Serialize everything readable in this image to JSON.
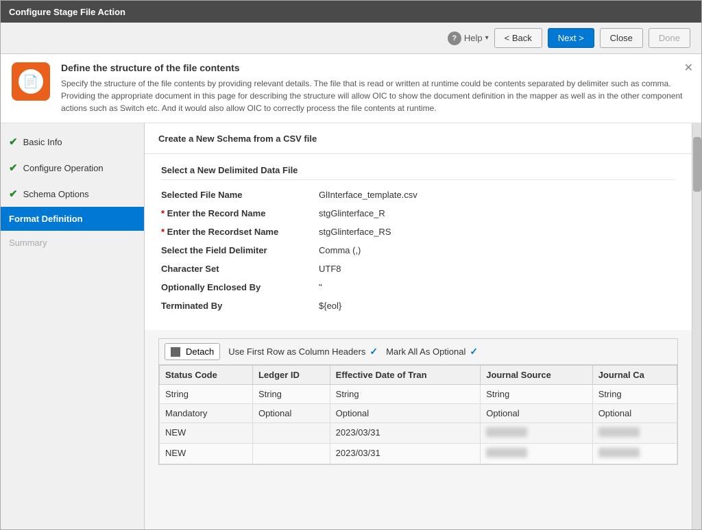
{
  "window": {
    "title": "Configure Stage File Action"
  },
  "toolbar": {
    "help_label": "Help",
    "back_label": "< Back",
    "next_label": "Next >",
    "close_label": "Close",
    "done_label": "Done"
  },
  "info_banner": {
    "heading": "Define the structure of the file contents",
    "description": "Specify the structure of the file contents by providing relevant details. The file that is read or written at runtime could be contents separated by delimiter such as comma. Providing the appropriate document in this page for describing the structure will allow OIC to show the document definition in the mapper as well as in the other component actions such as Switch etc. And it would also allow OIC to correctly process the file contents at runtime."
  },
  "sidebar": {
    "items": [
      {
        "id": "basic-info",
        "label": "Basic Info",
        "status": "done",
        "active": false
      },
      {
        "id": "configure-operation",
        "label": "Configure Operation",
        "status": "done",
        "active": false
      },
      {
        "id": "schema-options",
        "label": "Schema Options",
        "status": "done",
        "active": false
      },
      {
        "id": "format-definition",
        "label": "Format Definition",
        "status": "active",
        "active": true
      },
      {
        "id": "summary",
        "label": "Summary",
        "status": "none",
        "active": false
      }
    ]
  },
  "main": {
    "schema_title": "Create a New Schema from a CSV file",
    "section_title": "Select a New Delimited Data File",
    "fields": [
      {
        "label": "Selected File Name",
        "value": "GlInterface_template.csv",
        "required": false
      },
      {
        "label": "Enter the Record Name",
        "value": "stgGlinterface_R",
        "required": true
      },
      {
        "label": "Enter the Recordset Name",
        "value": "stgGlinterface_RS",
        "required": true
      },
      {
        "label": "Select the Field Delimiter",
        "value": "Comma (,)",
        "required": false
      },
      {
        "label": "Character Set",
        "value": "UTF8",
        "required": false
      },
      {
        "label": "Optionally Enclosed By",
        "value": "\"",
        "required": false
      },
      {
        "label": "Terminated By",
        "value": "${eol}",
        "required": false
      }
    ],
    "table": {
      "detach_label": "Detach",
      "option1_label": "Use First Row as Column Headers",
      "option2_label": "Mark All As Optional",
      "columns": [
        {
          "name": "Status Code",
          "type": "String",
          "constraint": "Mandatory"
        },
        {
          "name": "Ledger ID",
          "type": "String",
          "constraint": "Optional"
        },
        {
          "name": "Effective Date of Tran",
          "type": "String",
          "constraint": "Optional"
        },
        {
          "name": "Journal Source",
          "type": "String",
          "constraint": "Optional"
        },
        {
          "name": "Journal Ca",
          "type": "String",
          "constraint": "Optional"
        }
      ],
      "rows": [
        {
          "col1": "NEW",
          "col2": "",
          "col3": "2023/03/31",
          "col4": "BLURRED",
          "col5": "BLURRED"
        },
        {
          "col1": "NEW",
          "col2": "",
          "col3": "2023/03/31",
          "col4": "BLURRED",
          "col5": "BLURRED"
        }
      ]
    }
  }
}
